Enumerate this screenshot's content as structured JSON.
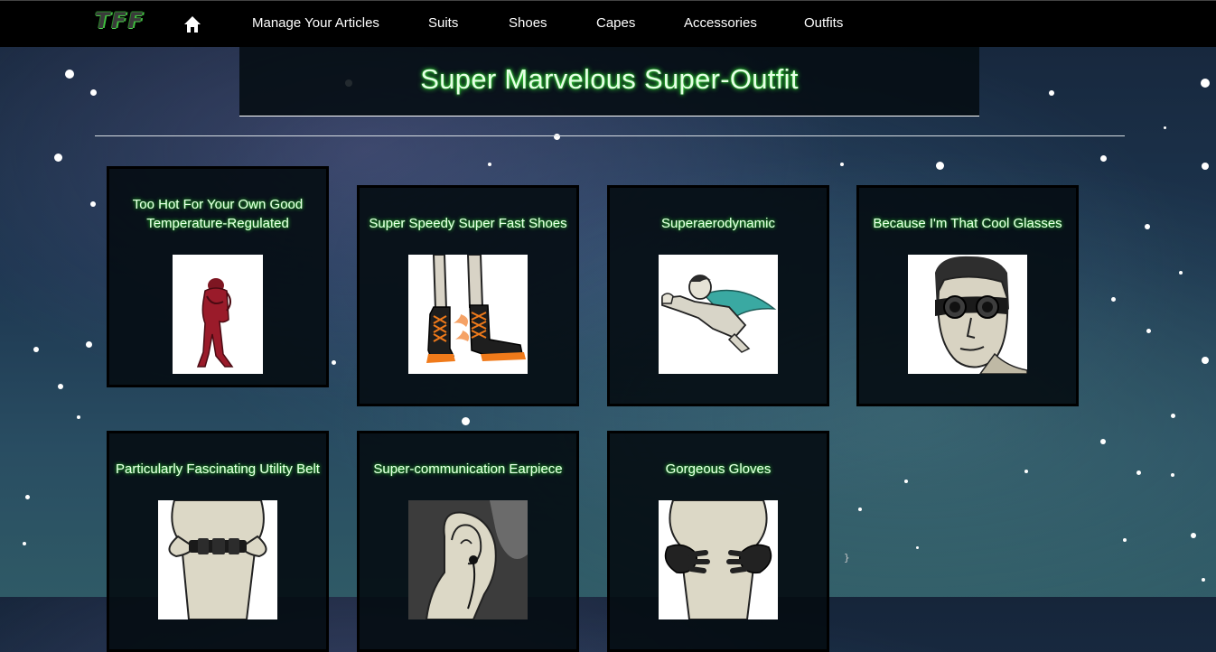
{
  "nav": {
    "logo": "TFF",
    "home_icon": "home-icon",
    "items": [
      {
        "label": "Manage Your Articles"
      },
      {
        "label": "Suits"
      },
      {
        "label": "Shoes"
      },
      {
        "label": "Capes"
      },
      {
        "label": "Accessories"
      },
      {
        "label": "Outfits"
      }
    ]
  },
  "page": {
    "title": "Super Marvelous Super-Outfit",
    "stray_text": "}"
  },
  "articles": [
    {
      "title": "Too Hot For Your Own Good Temperature-Regulated",
      "image_icon": "red-suit-figure-icon"
    },
    {
      "title": "Super Speedy Super Fast Shoes",
      "image_icon": "boots-icon"
    },
    {
      "title": "Superaerodynamic",
      "image_icon": "flying-hero-cape-icon"
    },
    {
      "title": "Because I'm That Cool Glasses",
      "image_icon": "goggles-face-icon"
    },
    {
      "title": "Particularly Fascinating Utility Belt",
      "image_icon": "utility-belt-icon"
    },
    {
      "title": "Super-communication Earpiece",
      "image_icon": "earpiece-icon"
    },
    {
      "title": "Gorgeous Gloves",
      "image_icon": "gloves-icon"
    }
  ],
  "colors": {
    "nav_bg": "#000000",
    "title_glow": "#3aff3a",
    "card_bg": "#040c12"
  }
}
